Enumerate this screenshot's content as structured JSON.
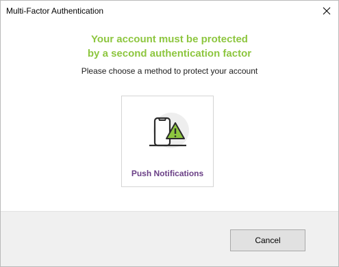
{
  "window": {
    "title": "Multi-Factor Authentication",
    "close_icon": "close-icon"
  },
  "main": {
    "headline_line1": "Your account must be protected",
    "headline_line2": "by a second authentication factor",
    "subtitle": "Please choose a method to protect your account",
    "methods": [
      {
        "label": "Push Notifications",
        "icon": "phone-warning-icon"
      }
    ]
  },
  "footer": {
    "cancel_label": "Cancel"
  },
  "colors": {
    "headline": "#8dc63f",
    "method_label": "#6a3f86",
    "footer_bg": "#f0f0f0"
  }
}
